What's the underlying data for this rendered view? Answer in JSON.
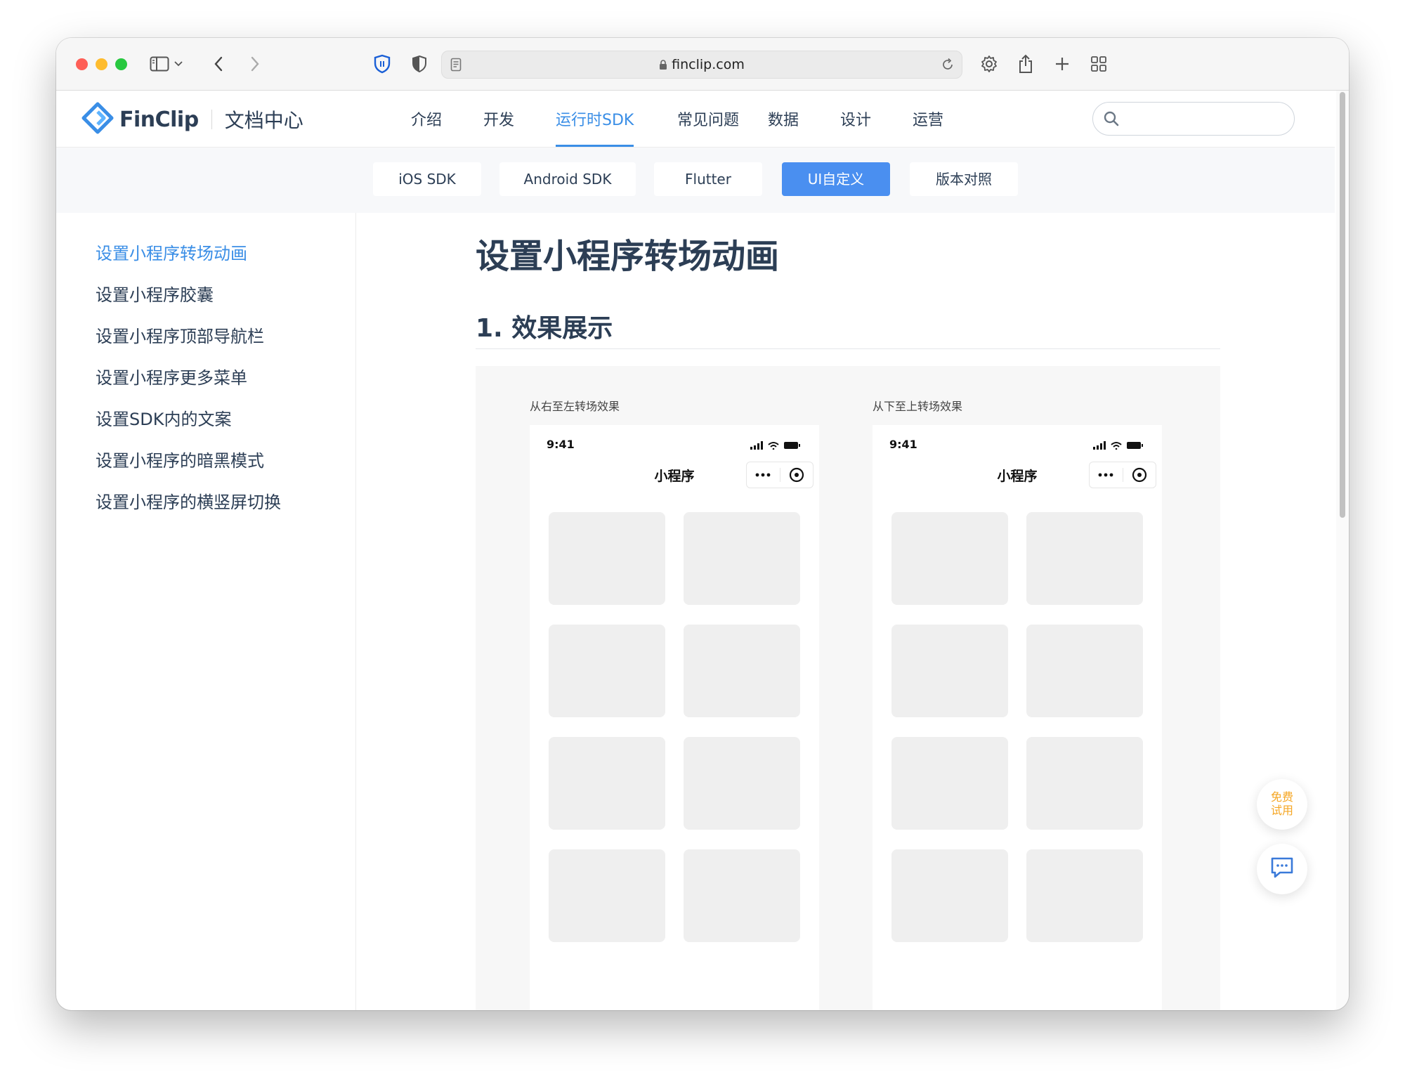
{
  "browser": {
    "url": "finclip.com"
  },
  "header": {
    "logo_text": "FinClip",
    "logo_sub": "文档中心",
    "nav": [
      "介绍",
      "开发",
      "运行时SDK",
      "常见问题",
      "数据",
      "设计",
      "运营"
    ],
    "active_nav": "运行时SDK",
    "search_placeholder": ""
  },
  "subtabs": {
    "items": [
      "iOS SDK",
      "Android SDK",
      "Flutter",
      "UI自定义",
      "版本对照"
    ],
    "active": "UI自定义"
  },
  "sidebar": {
    "items": [
      "设置小程序转场动画",
      "设置小程序胶囊",
      "设置小程序顶部导航栏",
      "设置小程序更多菜单",
      "设置SDK内的文案",
      "设置小程序的暗黑模式",
      "设置小程序的横竖屏切换"
    ],
    "active": "设置小程序转场动画"
  },
  "content": {
    "title": "设置小程序转场动画",
    "section": "1. 效果展示",
    "demos": [
      {
        "caption": "从右至左转场效果",
        "time": "9:41",
        "title": "小程序"
      },
      {
        "caption": "从下至上转场效果",
        "time": "9:41",
        "title": "小程序"
      }
    ]
  },
  "floating": {
    "trial_line1": "免费",
    "trial_line2": "试用"
  },
  "colors": {
    "accent": "#3a8ee6",
    "active_tab": "#4a8ff0",
    "trial": "#f5a623",
    "text": "#2c3e55"
  }
}
